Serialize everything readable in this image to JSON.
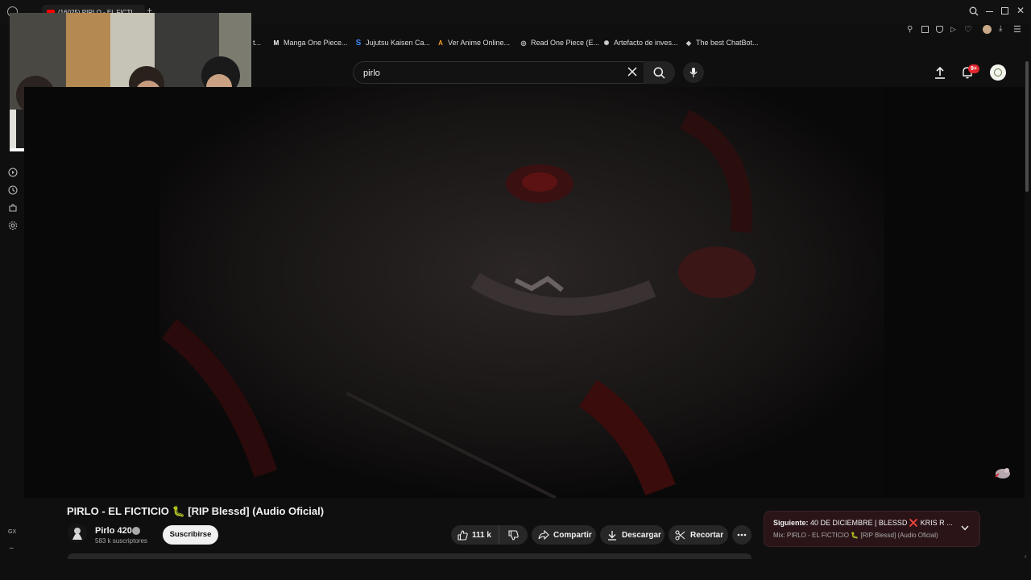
{
  "browser": {
    "tab_title": "(16025) PIRLO - EL FICTI...",
    "bookmarks": [
      {
        "label": "t...",
        "icon": "bookmark-icon"
      },
      {
        "label": "Manga One Piece...",
        "icon": "manga-logo-icon"
      },
      {
        "label": "Jujutsu Kaisen Ca...",
        "icon": "s-logo-icon"
      },
      {
        "label": "Ver Anime Online...",
        "icon": "anime-logo-icon"
      },
      {
        "label": "Read One Piece (E...",
        "icon": "globe-icon"
      },
      {
        "label": "Artefacto de inves...",
        "icon": "openai-icon"
      },
      {
        "label": "The best ChatBot...",
        "icon": "chatbot-icon"
      }
    ]
  },
  "header": {
    "search": {
      "value": "pirlo"
    },
    "notifications_badge": "9+"
  },
  "rail": {
    "bottom_label": "GX",
    "more_label": "..."
  },
  "video": {
    "title": "PIRLO - EL FICTICIO 🐛 [RIP Blessd] (Audio Oficial)",
    "channel": {
      "name": "Pirlo 420",
      "subscribers": "583 k suscriptores"
    },
    "subscribe_label": "Suscribirse",
    "likes": "111 k",
    "share_label": "Compartir",
    "download_label": "Descargar",
    "clip_label": "Recortar"
  },
  "up_next": {
    "prefix": "Siguiente:",
    "title": "40 DE DICIEMBRE | BLESSD ❌ KRIS R ...",
    "subtitle": "Mix: PIRLO - EL FICTICIO 🐛 [RIP Blessd] (Audio Oficial)"
  },
  "colors": {
    "accent_red": "#cc0000",
    "badge_red": "#e0282e",
    "card_bg": "#2a1418"
  }
}
